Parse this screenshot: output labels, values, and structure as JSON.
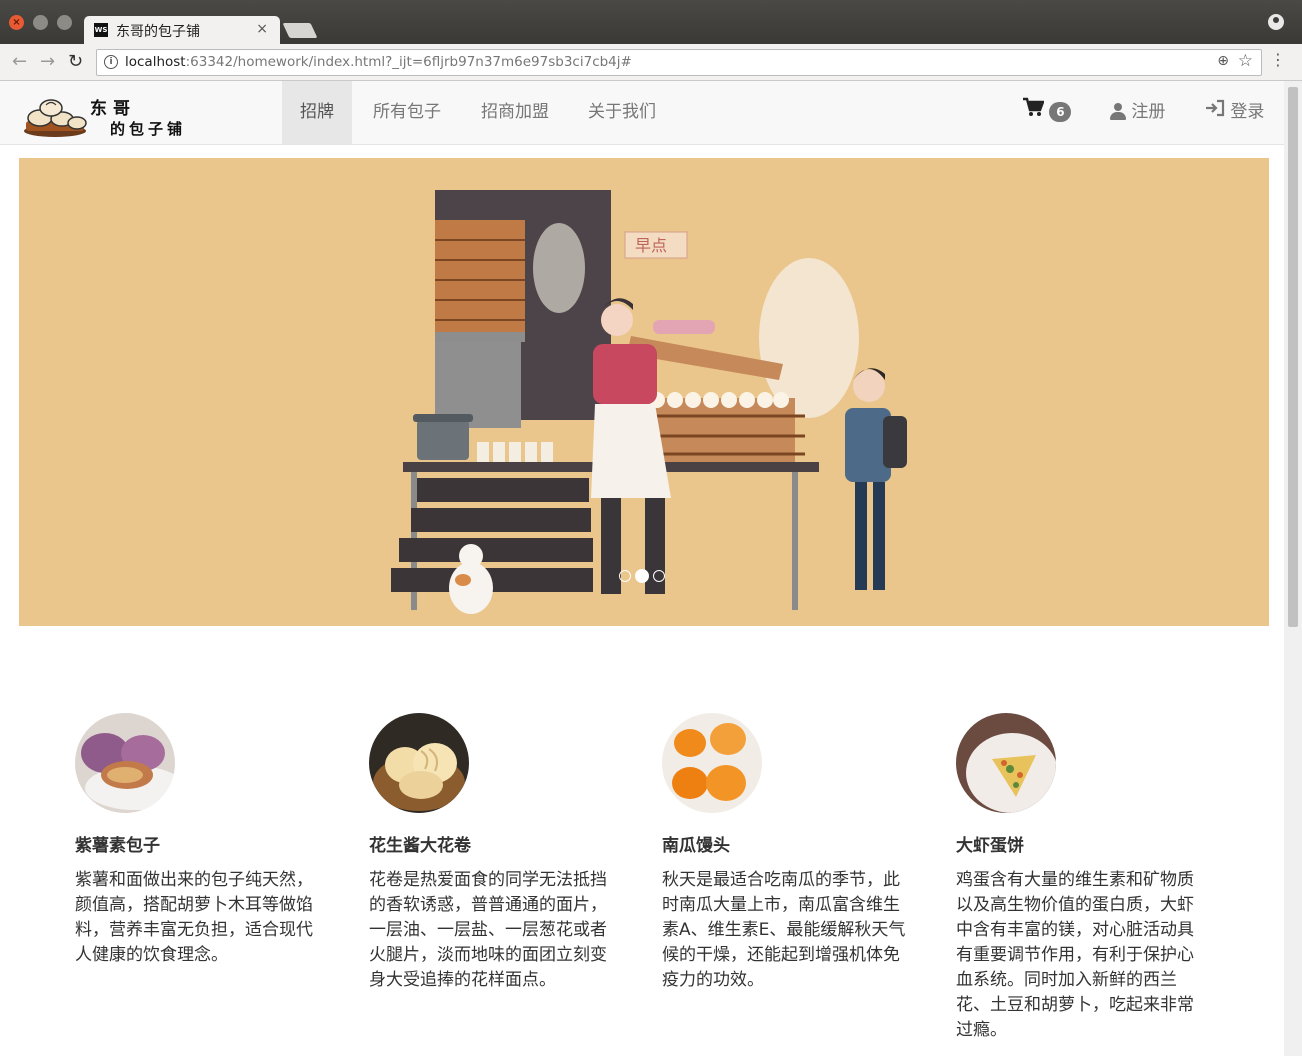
{
  "browser": {
    "tab_title": "东哥的包子铺",
    "tab_close": "×",
    "favicon_text": "WS",
    "url_host": "localhost",
    "url_rest": ":63342/homework/index.html?_ijt=6fljrb97n37m6e97sb3ci7cb4j#"
  },
  "site": {
    "logo_line1": "东哥",
    "logo_line2": "的包子铺",
    "nav": [
      {
        "label": "招牌",
        "active": true
      },
      {
        "label": "所有包子"
      },
      {
        "label": "招商加盟"
      },
      {
        "label": "关于我们"
      }
    ],
    "cart_count": "6",
    "register_label": "注册",
    "login_label": "登录"
  },
  "carousel": {
    "sign_text": "早点",
    "slide_count": 3,
    "active_slide": 1
  },
  "features": [
    {
      "title": "紫薯素包子",
      "desc": "紫薯和面做出来的包子纯天然，颜值高，搭配胡萝卜木耳等做馅料，营养丰富无负担，适合现代人健康的饮食理念。"
    },
    {
      "title": "花生酱大花卷",
      "desc": "花卷是热爱面食的同学无法抵挡的香软诱惑，普普通通的面片，一层油、一层盐、一层葱花或者火腿片，淡而地味的面团立刻变身大受追捧的花样面点。"
    },
    {
      "title": "南瓜馒头",
      "desc": "秋天是最适合吃南瓜的季节，此时南瓜大量上市，南瓜富含维生素A、维生素E、最能缓解秋天气候的干燥，还能起到增强机体免疫力的功效。"
    },
    {
      "title": "大虾蛋饼",
      "desc": "鸡蛋含有大量的维生素和矿物质以及高生物价值的蛋白质，大虾中含有丰富的镁，对心脏活动具有重要调节作用，有利于保护心血系统。同时加入新鲜的西兰花、土豆和胡萝卜，吃起来非常过瘾。"
    }
  ],
  "colors": {
    "banner_bg": "#ebc68c",
    "nav_active_bg": "#e7e7e7"
  }
}
